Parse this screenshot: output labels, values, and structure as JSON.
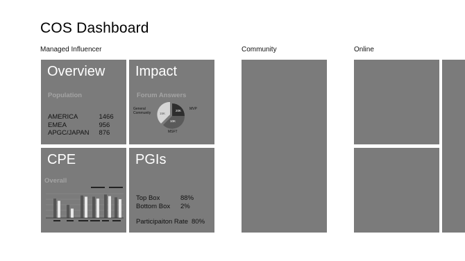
{
  "app": {
    "title": "COS Dashboard"
  },
  "groups": {
    "managed_influencer": {
      "label": "Managed Influencer"
    },
    "community": {
      "label": "Community"
    },
    "online": {
      "label": "Online"
    }
  },
  "tiles": {
    "overview": {
      "title": "Overview",
      "subtitle": "Population",
      "rows": [
        {
          "region": "AMERICA",
          "value": "1466"
        },
        {
          "region": "EMEA",
          "value": "956"
        },
        {
          "region": "APGC/JAPAN",
          "value": "876"
        }
      ]
    },
    "impact": {
      "title": "Impact",
      "subtitle": "Forum Answers",
      "chart_data": {
        "type": "pie",
        "slices": [
          {
            "label": "MVP",
            "value_label": "20K",
            "color": "#2e2e2e"
          },
          {
            "label": "MSFT",
            "value_label": "10K",
            "color": "#5a5a5a"
          },
          {
            "label": "General Community",
            "value_label": "15K",
            "color": "#d6d6d6"
          }
        ]
      }
    },
    "cpe": {
      "title": "CPE",
      "subtitle": "Overall",
      "chart_data": {
        "type": "bar",
        "series": [
          {
            "values": [
              0.62,
              0.42,
              0.72,
              0.68,
              0.75,
              0.66
            ],
            "color": "#555555"
          },
          {
            "values": [
              0.55,
              0.3,
              0.68,
              0.62,
              0.7,
              0.6
            ],
            "color": "#e8e8e8"
          }
        ]
      }
    },
    "pgis": {
      "title": "PGIs",
      "rows": [
        {
          "label": "Top Box",
          "value": "88%"
        },
        {
          "label": "Bottom Box",
          "value": "2%"
        },
        {
          "label": "Participaiton Rate",
          "value": "80%"
        }
      ]
    }
  },
  "colors": {
    "tile": "#7b7b7b",
    "background": "#ffffff"
  }
}
